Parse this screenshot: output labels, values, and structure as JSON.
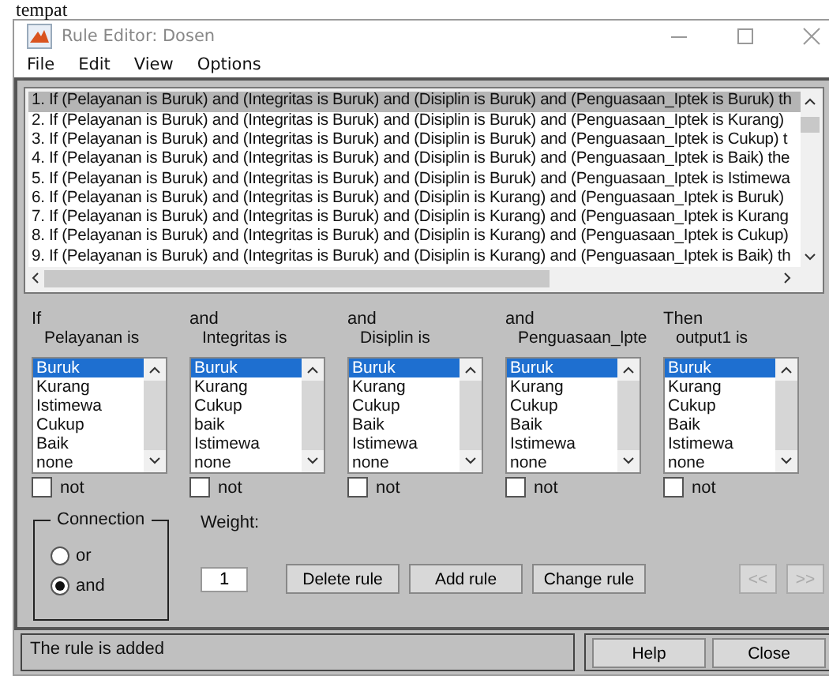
{
  "above_window_text": "tempat",
  "window": {
    "title": "Rule Editor: Dosen"
  },
  "menu": [
    "File",
    "Edit",
    "View",
    "Options"
  ],
  "rules": [
    {
      "text": "1. If (Pelayanan is Buruk) and (Integritas is Buruk) and (Disiplin is Buruk) and (Penguasaan_Iptek is Buruk) th",
      "selected": true
    },
    {
      "text": "2. If (Pelayanan is Buruk) and (Integritas is Buruk) and (Disiplin is Buruk) and (Penguasaan_Iptek is Kurang)",
      "selected": false
    },
    {
      "text": "3. If (Pelayanan is Buruk) and (Integritas is Buruk) and (Disiplin is Buruk) and (Penguasaan_Iptek is Cukup) t",
      "selected": false
    },
    {
      "text": "4. If (Pelayanan is Buruk) and (Integritas is Buruk) and (Disiplin is Buruk) and (Penguasaan_Iptek is Baik) the",
      "selected": false
    },
    {
      "text": "5. If (Pelayanan is Buruk) and (Integritas is Buruk) and (Disiplin is Buruk) and (Penguasaan_Iptek is Istimewa",
      "selected": false
    },
    {
      "text": "6. If (Pelayanan is Buruk) and (Integritas is Buruk) and (Disiplin is Kurang) and (Penguasaan_Iptek is Buruk)",
      "selected": false
    },
    {
      "text": "7. If (Pelayanan is Buruk) and (Integritas is Buruk) and (Disiplin is Kurang) and (Penguasaan_Iptek is Kurang",
      "selected": false
    },
    {
      "text": "8. If (Pelayanan is Buruk) and (Integritas is Buruk) and (Disiplin is Kurang) and (Penguasaan_Iptek is Cukup)",
      "selected": false
    },
    {
      "text": "9. If (Pelayanan is Buruk) and (Integritas is Buruk) and (Disiplin is Kurang) and (Penguasaan_Iptek is Baik) th",
      "selected": false
    }
  ],
  "columns": [
    {
      "connector": "If",
      "variable": "Pelayanan is",
      "not": false,
      "items": [
        {
          "label": "Buruk",
          "selected": true
        },
        {
          "label": "Kurang",
          "selected": false
        },
        {
          "label": "Istimewa",
          "selected": false
        },
        {
          "label": "Cukup",
          "selected": false
        },
        {
          "label": "Baik",
          "selected": false
        },
        {
          "label": "none",
          "selected": false
        }
      ]
    },
    {
      "connector": "and",
      "variable": "Integritas is",
      "not": false,
      "items": [
        {
          "label": "Buruk",
          "selected": true
        },
        {
          "label": "Kurang",
          "selected": false
        },
        {
          "label": "Cukup",
          "selected": false
        },
        {
          "label": "baik",
          "selected": false
        },
        {
          "label": "Istimewa",
          "selected": false
        },
        {
          "label": "none",
          "selected": false
        }
      ]
    },
    {
      "connector": "and",
      "variable": "Disiplin is",
      "not": false,
      "items": [
        {
          "label": "Buruk",
          "selected": true
        },
        {
          "label": "Kurang",
          "selected": false
        },
        {
          "label": "Cukup",
          "selected": false
        },
        {
          "label": "Baik",
          "selected": false
        },
        {
          "label": "Istimewa",
          "selected": false
        },
        {
          "label": "none",
          "selected": false
        }
      ]
    },
    {
      "connector": "and",
      "variable": "Penguasaan_lpte",
      "not": false,
      "items": [
        {
          "label": "Buruk",
          "selected": true
        },
        {
          "label": "Kurang",
          "selected": false
        },
        {
          "label": "Cukup",
          "selected": false
        },
        {
          "label": "Baik",
          "selected": false
        },
        {
          "label": "Istimewa",
          "selected": false
        },
        {
          "label": "none",
          "selected": false
        }
      ]
    },
    {
      "connector": "Then",
      "variable": "output1 is",
      "not": false,
      "items": [
        {
          "label": "Buruk",
          "selected": true
        },
        {
          "label": "Kurang",
          "selected": false
        },
        {
          "label": "Cukup",
          "selected": false
        },
        {
          "label": "Baik",
          "selected": false
        },
        {
          "label": "Istimewa",
          "selected": false
        },
        {
          "label": "none",
          "selected": false
        }
      ]
    }
  ],
  "not_labels": [
    "not",
    "not",
    "not",
    "not",
    "not"
  ],
  "connection": {
    "label": "Connection",
    "options": [
      {
        "label": "or",
        "selected": false
      },
      {
        "label": "and",
        "selected": true
      }
    ]
  },
  "weight": {
    "label": "Weight:",
    "value": "1"
  },
  "buttons": [
    {
      "label": "Delete rule",
      "disabled": false
    },
    {
      "label": "Add rule",
      "disabled": false
    },
    {
      "label": "Change rule",
      "disabled": false
    }
  ],
  "nav_buttons": [
    {
      "label": "<<",
      "disabled": true
    },
    {
      "label": ">>",
      "disabled": true
    }
  ],
  "status": "The rule is added",
  "footer_buttons": [
    "Help",
    "Close"
  ]
}
